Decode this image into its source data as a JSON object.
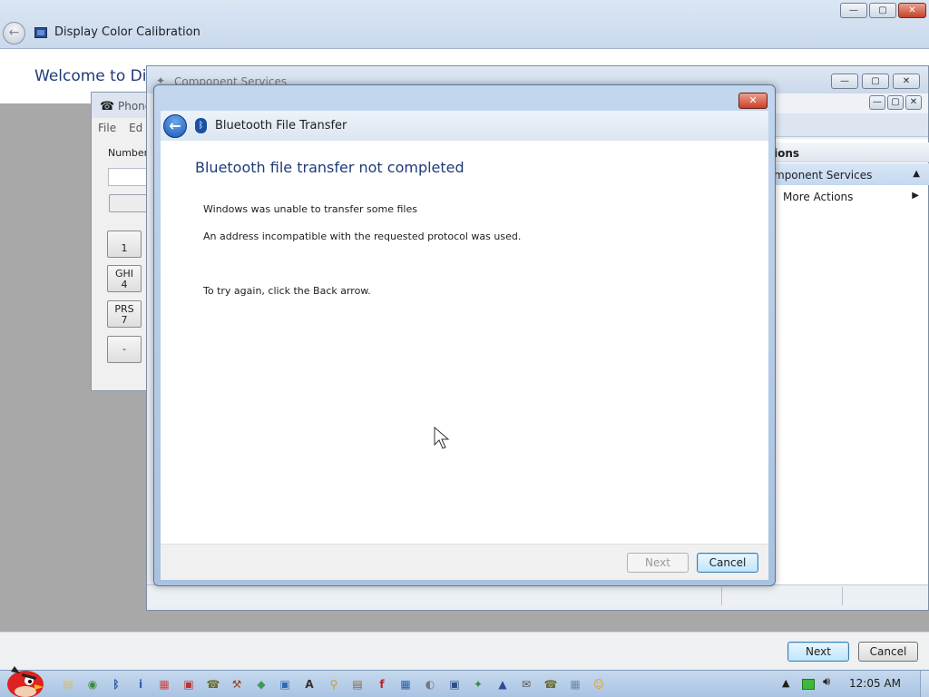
{
  "dcc": {
    "title": "Display Color Calibration",
    "welcome": "Welcome to Disp",
    "next": "Next",
    "cancel": "Cancel",
    "caption": {
      "min": "—",
      "max": "▢",
      "close": "✕"
    }
  },
  "phone": {
    "title": "Phone",
    "menu": [
      "File",
      "Ed"
    ],
    "number_label": "Number t",
    "keys": [
      {
        "letters": "",
        "digit": "1"
      },
      {
        "letters": "GHI",
        "digit": "4"
      },
      {
        "letters": "PRS",
        "digit": "7"
      },
      {
        "letters": "",
        "digit": "-"
      }
    ]
  },
  "cs": {
    "title": "Component Services",
    "actions_header": "ions",
    "section": "mponent Services",
    "more_actions": "More Actions",
    "caption": {
      "min": "—",
      "max": "▢",
      "close": "✕"
    }
  },
  "bt": {
    "header_title": "Bluetooth File Transfer",
    "main_title": "Bluetooth file transfer not completed",
    "line1": "Windows was unable to transfer some files",
    "line2": "An address incompatible with the requested protocol was used.",
    "line3": "To try again, click the Back arrow.",
    "next": "Next",
    "cancel": "Cancel",
    "close": "✕",
    "back_glyph": "←",
    "bt_glyph": "ᛒ"
  },
  "taskbar": {
    "clock": "12:05 AM",
    "icons": [
      {
        "name": "folder-icon",
        "color": "#e8b84a",
        "glyph": "▤"
      },
      {
        "name": "chrome-icon",
        "color": "#3a8a3a",
        "glyph": "◉"
      },
      {
        "name": "bluetooth-icon",
        "color": "#1b4fa5",
        "glyph": "ᛒ"
      },
      {
        "name": "info-icon",
        "color": "#2a5db0",
        "glyph": "i"
      },
      {
        "name": "chart-icon",
        "color": "#c44",
        "glyph": "▦"
      },
      {
        "name": "printer-icon",
        "color": "#b33",
        "glyph": "▣"
      },
      {
        "name": "phone-dialer-icon",
        "color": "#6a6a2a",
        "glyph": "☎"
      },
      {
        "name": "tools-icon",
        "color": "#a04020",
        "glyph": "⚒"
      },
      {
        "name": "paint-icon",
        "color": "#3a9a5a",
        "glyph": "◆"
      },
      {
        "name": "network-icon",
        "color": "#2a6ab0",
        "glyph": "▣"
      },
      {
        "name": "font-icon",
        "color": "#333",
        "glyph": "A"
      },
      {
        "name": "search-icon",
        "color": "#c8a020",
        "glyph": "⚲"
      },
      {
        "name": "briefcase-icon",
        "color": "#8a6a2a",
        "glyph": "▤"
      },
      {
        "name": "flash-icon",
        "color": "#c02020",
        "glyph": "f"
      },
      {
        "name": "network-share-icon",
        "color": "#2a5db0",
        "glyph": "▦"
      },
      {
        "name": "disk-icon",
        "color": "#777",
        "glyph": "◐"
      },
      {
        "name": "display-icon",
        "color": "#2d4d8a",
        "glyph": "▣"
      },
      {
        "name": "component-services-icon",
        "color": "#3a8a3a",
        "glyph": "✦"
      },
      {
        "name": "mmc-icon",
        "color": "#2a4a9a",
        "glyph": "▲"
      },
      {
        "name": "fax-icon",
        "color": "#555",
        "glyph": "✉"
      },
      {
        "name": "phone-icon",
        "color": "#6a6a2a",
        "glyph": "☎"
      },
      {
        "name": "calculator-icon",
        "color": "#6a8ab0",
        "glyph": "▦"
      },
      {
        "name": "messenger-icon",
        "color": "#e0a020",
        "glyph": "☺"
      }
    ]
  }
}
